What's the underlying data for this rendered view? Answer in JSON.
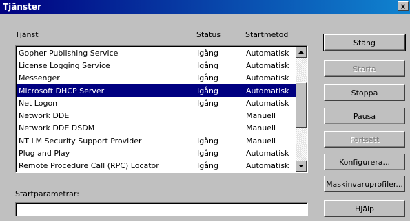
{
  "window": {
    "title": "Tjänster",
    "close_glyph": "×"
  },
  "columns": {
    "service": "Tjänst",
    "status": "Status",
    "startup": "Startmetod"
  },
  "services": [
    {
      "name": "Gopher Publishing Service",
      "status": "Igång",
      "startup": "Automatisk",
      "selected": false
    },
    {
      "name": "License Logging Service",
      "status": "Igång",
      "startup": "Automatisk",
      "selected": false
    },
    {
      "name": "Messenger",
      "status": "Igång",
      "startup": "Automatisk",
      "selected": false
    },
    {
      "name": "Microsoft DHCP Server",
      "status": "Igång",
      "startup": "Automatisk",
      "selected": true
    },
    {
      "name": "Net Logon",
      "status": "Igång",
      "startup": "Automatisk",
      "selected": false
    },
    {
      "name": "Network DDE",
      "status": "",
      "startup": "Manuell",
      "selected": false
    },
    {
      "name": "Network DDE DSDM",
      "status": "",
      "startup": "Manuell",
      "selected": false
    },
    {
      "name": "NT LM Security Support Provider",
      "status": "Igång",
      "startup": "Manuell",
      "selected": false
    },
    {
      "name": "Plug and Play",
      "status": "Igång",
      "startup": "Automatisk",
      "selected": false
    },
    {
      "name": "Remote Procedure Call (RPC) Locator",
      "status": "Igång",
      "startup": "Automatisk",
      "selected": false
    }
  ],
  "parameters": {
    "label": "Startparametrar:",
    "value": ""
  },
  "buttons": {
    "close": "Stäng",
    "start": "Starta",
    "stop": "Stoppa",
    "pause": "Pausa",
    "continue": "Fortsätt",
    "configure": "Konfigurera...",
    "hardware_profiles": "Maskinvaruprofiler...",
    "help": "Hjälp"
  },
  "icons": {
    "scroll_up": "triangle-up-icon",
    "scroll_down": "triangle-down-icon",
    "close": "close-icon"
  },
  "colors": {
    "title_start": "#000080",
    "title_end": "#1084d0",
    "selection": "#000080",
    "face": "#c0c0c0"
  }
}
